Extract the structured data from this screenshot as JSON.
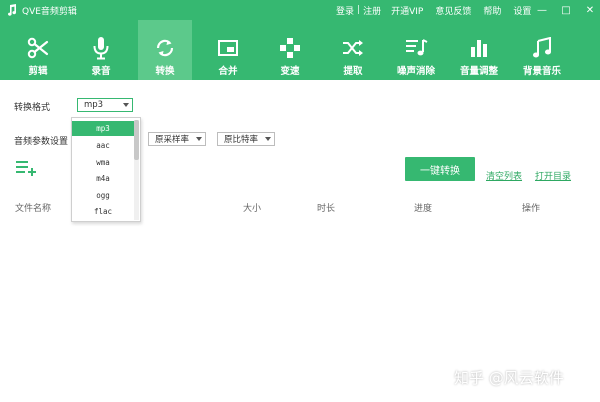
{
  "app": {
    "title": "QVE音频剪辑"
  },
  "titlebar": {
    "login": "登录",
    "separator": "|",
    "register": "注册",
    "vip": "开通VIP",
    "feedback": "意见反馈",
    "help": "帮助",
    "settings": "设置",
    "minimize": "—",
    "maximize": "□",
    "close": "✕"
  },
  "toolbar": {
    "items": [
      {
        "label": "剪辑",
        "icon": "scissors-icon"
      },
      {
        "label": "录音",
        "icon": "microphone-icon"
      },
      {
        "label": "转换",
        "icon": "convert-icon"
      },
      {
        "label": "合并",
        "icon": "merge-icon"
      },
      {
        "label": "变速",
        "icon": "speed-icon"
      },
      {
        "label": "提取",
        "icon": "extract-icon"
      },
      {
        "label": "噪声消除",
        "icon": "noise-removal-icon"
      },
      {
        "label": "音量调整",
        "icon": "volume-bars-icon"
      },
      {
        "label": "背景音乐",
        "icon": "music-note-icon"
      }
    ],
    "active_index": 2
  },
  "form": {
    "format_label": "转换格式",
    "format_value": "mp3",
    "params_label": "音频参数设置",
    "sample_rate_value": "原采样率",
    "bitrate_value": "原比特率"
  },
  "format_dropdown": {
    "options": [
      "mp3",
      "aac",
      "wma",
      "m4a",
      "ogg",
      "flac"
    ],
    "selected_index": 0
  },
  "actions": {
    "convert_button": "一键转换",
    "clear_list": "清空列表",
    "open_dir": "打开目录"
  },
  "table": {
    "columns": [
      "文件名称",
      "大小",
      "时长",
      "进度",
      "操作"
    ]
  },
  "watermark": {
    "text": "知乎 @风云软件"
  },
  "colors": {
    "brand": "#36b871",
    "brand_active": "#5cc98b",
    "link": "#2ea862"
  }
}
